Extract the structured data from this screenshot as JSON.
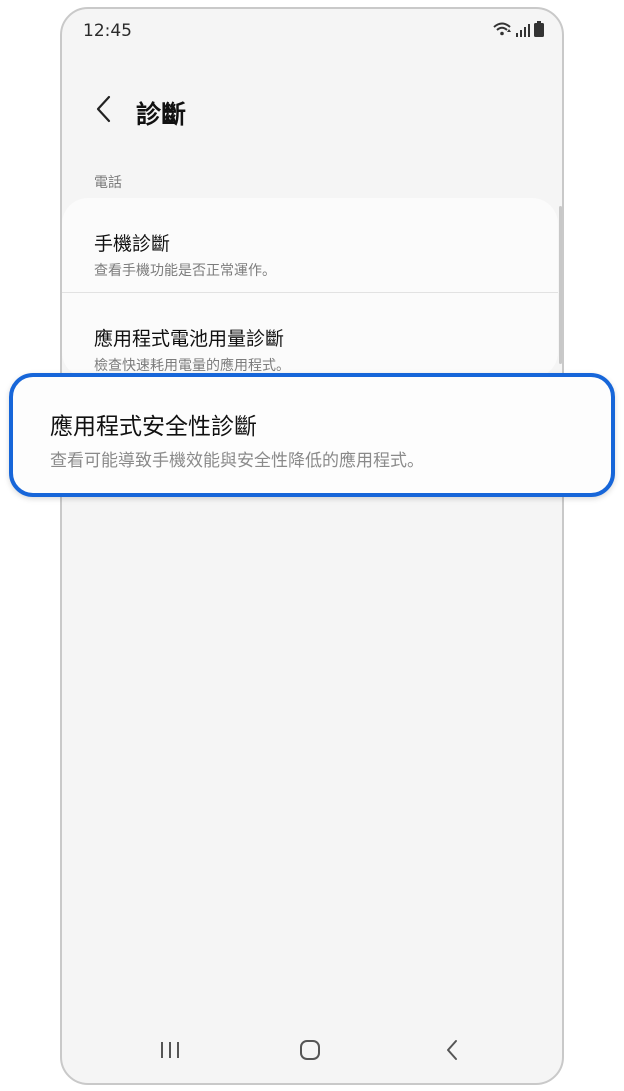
{
  "status_bar": {
    "time": "12:45",
    "icons": [
      "wifi-icon",
      "signal-icon",
      "battery-icon"
    ]
  },
  "header": {
    "back_icon": "chevron-left-icon",
    "title": "診斷"
  },
  "section": {
    "label": "電話"
  },
  "items": [
    {
      "title": "手機診斷",
      "subtitle": "查看手機功能是否正常運作。"
    },
    {
      "title": "應用程式電池用量診斷",
      "subtitle": "檢查快速耗用電量的應用程式。"
    }
  ],
  "highlighted_item": {
    "title": "應用程式安全性診斷",
    "subtitle": "查看可能導致手機效能與安全性降低的應用程式。",
    "border_color": "#1766d9"
  },
  "nav_bar": {
    "icons": [
      "recent-apps-icon",
      "home-icon",
      "back-icon"
    ]
  }
}
